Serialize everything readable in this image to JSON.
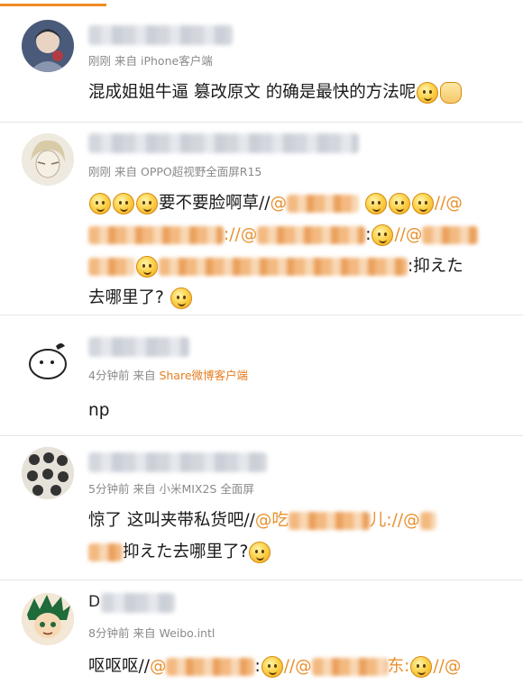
{
  "comments": [
    {
      "meta_time": "刚刚",
      "meta_from": "来自",
      "meta_source": "iPhone客户端",
      "text_1": "混成姐姐牛逼 篡改原文 的确是最快的方法呢"
    },
    {
      "meta_time": "刚刚",
      "meta_from": "来自",
      "meta_source": "OPPO超视野全面屏R15",
      "text_1": "要不要脸啊草//",
      "at": "@",
      "at2": "//@",
      "sep1": "://@",
      "sep2": ":",
      "sep3": "//@",
      "text_tail": ":抑えた",
      "text_2": "去哪里了?"
    },
    {
      "meta_time": "4分钟前",
      "meta_from": "来自",
      "meta_source": "Share微博客户端",
      "text_1": "np"
    },
    {
      "meta_time": "5分钟前",
      "meta_from": "来自",
      "meta_source": "小米MIX2S 全面屏",
      "text_1": "惊了 这叫夹带私货吧//",
      "at_a": "@吃",
      "at_a_end": "儿://",
      "at_b": "@",
      "text_2": "抑えた去哪里了?"
    },
    {
      "meta_time": "8分钟前",
      "meta_from": "来自",
      "meta_source": "Weibo.intl",
      "name_prefix": "D",
      "text_1": "呕呕呕//",
      "at_a": "@",
      "sep1": ":",
      "sep2": "//@",
      "at_b_end": "东:",
      "sep3": "//@"
    }
  ],
  "colors": {
    "accent": "#f08a24",
    "mention": "#e8912e",
    "meta": "#8a8a8a"
  }
}
